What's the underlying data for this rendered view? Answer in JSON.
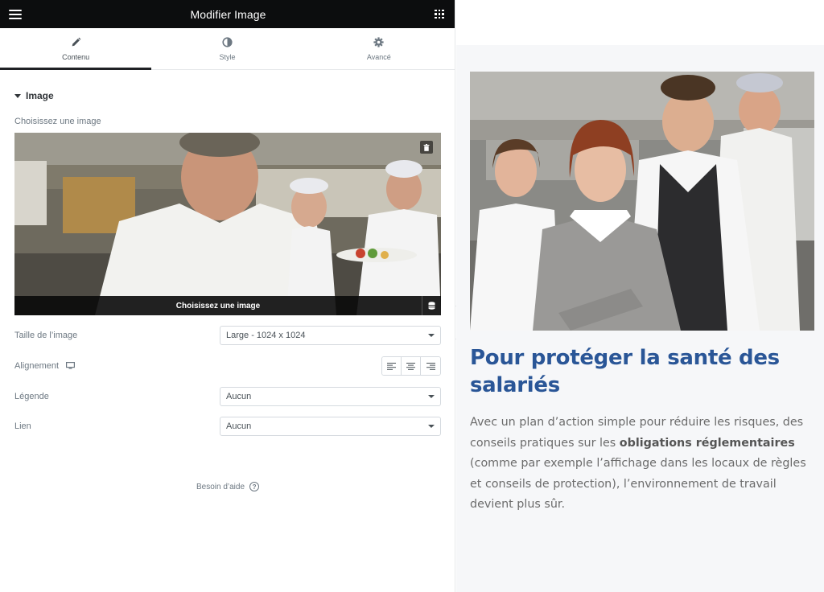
{
  "topbar": {
    "title": "Modifier Image",
    "menu_icon": "hamburger-icon",
    "apps_icon": "grid-icon"
  },
  "tabs": [
    {
      "label": "Contenu",
      "icon": "pencil-icon",
      "active": true
    },
    {
      "label": "Style",
      "icon": "half-circle-icon",
      "active": false
    },
    {
      "label": "Avancé",
      "icon": "gear-icon",
      "active": false
    }
  ],
  "section": {
    "title": "Image"
  },
  "image_picker": {
    "label": "Choisissez une image",
    "button_label": "Choisissez une image"
  },
  "fields": {
    "size": {
      "label": "Taille de l’image",
      "value": "Large - 1024 x 1024"
    },
    "alignment": {
      "label": "Alignement",
      "device_icon": "desktop-icon",
      "options": [
        "left",
        "center",
        "right"
      ]
    },
    "caption": {
      "label": "Légende",
      "value": "Aucun"
    },
    "link": {
      "label": "Lien",
      "value": "Aucun"
    }
  },
  "help": {
    "label": "Besoin d’aide"
  },
  "preview": {
    "heading": "Pour protéger la santé des salariés",
    "paragraph_parts": {
      "p1": "Avec un plan d’action simple pour réduire les risques, des conseils pratiques sur les ",
      "bold": "obligations réglementaires",
      "p2": " (comme par exemple l’affichage dans les locaux de règles et conseils de protection), l’environnement de travail devient plus sûr."
    }
  },
  "colors": {
    "topbar": "#0c0d0e",
    "heading": "#2a5697",
    "canvas": "#f6f7f9"
  }
}
